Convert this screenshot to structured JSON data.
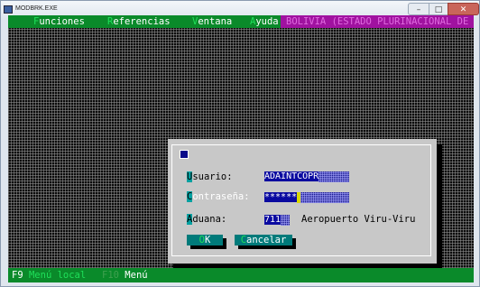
{
  "window": {
    "title": "MODBRK.EXE",
    "minimize_glyph": "–",
    "maximize_glyph": "□",
    "close_glyph": "✕"
  },
  "menubar": {
    "items": [
      {
        "hotkey": "F",
        "rest": "unciones"
      },
      {
        "hotkey": "R",
        "rest": "eferencias"
      },
      {
        "hotkey": "V",
        "rest": "entana"
      },
      {
        "hotkey": "A",
        "rest": "yuda"
      }
    ],
    "country": "BOLIVIA (ESTADO PLURINACIONAL DE"
  },
  "login": {
    "usuario": {
      "hotkey": "U",
      "rest": "suario:",
      "value": "ADAINTCOPR"
    },
    "contrasena": {
      "hotkey": "C",
      "rest": "ontraseña:",
      "value": "******"
    },
    "aduana": {
      "hotkey": "A",
      "rest": "duana:",
      "code": "711",
      "name": "Aeropuerto Viru-Viru"
    },
    "ok": {
      "hotkey": "O",
      "rest": "K"
    },
    "cancel": {
      "hotkey": "C",
      "rest": "ancelar"
    }
  },
  "statusbar": {
    "items": [
      {
        "key": "F9",
        "label": "Menú local"
      },
      {
        "key": "F10",
        "label": "Menú"
      }
    ]
  },
  "colors": {
    "menu_bg": "#0a8a2a",
    "country_bg": "#a012a0",
    "dialog_bg": "#c8c8c8",
    "field_bg": "#0a0aa0",
    "button_bg": "#007a7a"
  }
}
